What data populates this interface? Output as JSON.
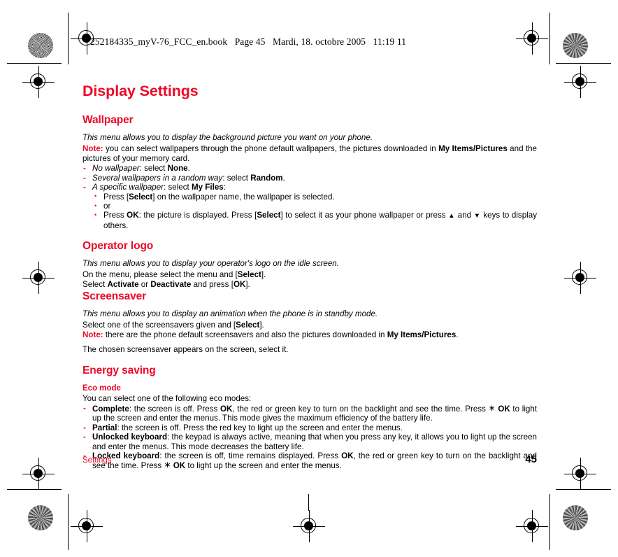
{
  "file_header": {
    "filename": "252184335_myV-76_FCC_en.book",
    "page_label": "Page 45",
    "date": "Mardi, 18. octobre 2005",
    "time": "11:19 11"
  },
  "chapter_title": "Display Settings",
  "colors": {
    "accent_red": "#ec0928",
    "text_black": "#000000",
    "page_background": "#ffffff"
  },
  "sections": {
    "wallpaper": {
      "heading": "Wallpaper",
      "intro": "This menu allows you to display the background picture you want on your phone.",
      "note_label": "Note:",
      "note_text_1": " you can select wallpapers through the phone default wallpapers, the pictures downloaded in ",
      "note_bold_1": "My Items/Pictures",
      "note_text_2": " and the pictures of your memory card.",
      "items": [
        {
          "italic": "No wallpaper",
          "mid": ": select ",
          "bold": "None",
          "end": "."
        },
        {
          "italic": "Several wallpapers in a random way",
          "mid": ": select ",
          "bold": "Random",
          "end": "."
        },
        {
          "italic": "A specific wallpaper",
          "mid": ": select ",
          "bold": "My Files",
          "end": ":"
        }
      ],
      "subitems": {
        "first_pre": "Press [",
        "first_bold": "Select",
        "first_post": "] on the wallpaper name, the wallpaper is selected.",
        "or": "or",
        "second_pre": "Press ",
        "second_bold_1": "OK",
        "second_mid_1": ": the picture is displayed. Press [",
        "second_bold_2": "Select",
        "second_mid_2": "] to select it as your phone wallpaper or press ",
        "arrow_up": "▲",
        "second_mid_3": " and ",
        "arrow_down": "▼",
        "second_end": " keys to display others."
      }
    },
    "operator_logo": {
      "heading": "Operator logo",
      "intro": "This menu allows you to display your operator's logo on the idle screen.",
      "line1_pre": "On the  menu, please select the menu and [",
      "line1_bold": "Select",
      "line1_post": "].",
      "line2_pre": "Select ",
      "line2_bold_1": "Activate",
      "line2_mid": " or ",
      "line2_bold_2": "Deactivate",
      "line2_mid_2": " and press [",
      "line2_bold_3": "OK",
      "line2_post": "]."
    },
    "screensaver": {
      "heading": "Screensaver",
      "intro": "This menu allows you to display an animation when the phone is in standby mode.",
      "line1_pre": "Select one of the screensavers given and [",
      "line1_bold": "Select",
      "line1_post": "].",
      "note_label": "Note:",
      "note_text_1": " there are the phone default screensavers and also the pictures downloaded in ",
      "note_bold_1": "My Items/Pictures",
      "note_text_2": ".",
      "closing": "The chosen screensaver appears on the screen, select it."
    },
    "energy_saving": {
      "heading": "Energy saving",
      "sub_heading": "Eco mode",
      "lead": "You can select one of the following eco modes:",
      "modes": [
        {
          "bold": "Complete",
          "text_1": ": the screen is off. Press ",
          "bold_2": "OK",
          "text_2": ", the red or green key to turn on the backlight and see the time. Press  ",
          "asterisk": "∗",
          "bold_3": " OK",
          "text_3": " to light up the screen and enter the menus. This mode gives the maximum efficiency of the battery life."
        },
        {
          "bold": "Partial",
          "text_1": ": the screen is off. Press the red key to light up the screen and enter the menus.",
          "bold_2": "",
          "text_2": "",
          "asterisk": "",
          "bold_3": "",
          "text_3": ""
        },
        {
          "bold": "Unlocked keyboard",
          "text_1": ": the keypad is always active, meaning that when you press any key, it allows you to light up the screen and enter the menus. This mode decreases the battery life.",
          "bold_2": "",
          "text_2": "",
          "asterisk": "",
          "bold_3": "",
          "text_3": ""
        },
        {
          "bold": "Locked keyboard",
          "text_1": ": the screen is off, time remains displayed. Press ",
          "bold_2": "OK",
          "text_2": ", the red or green key to turn on the backlight and see the time. Press ",
          "asterisk": "∗",
          "bold_3": " OK",
          "text_3": " to light up the screen and enter the menus."
        }
      ]
    }
  },
  "footer": {
    "chapter": "Settings",
    "page_number": "45"
  }
}
